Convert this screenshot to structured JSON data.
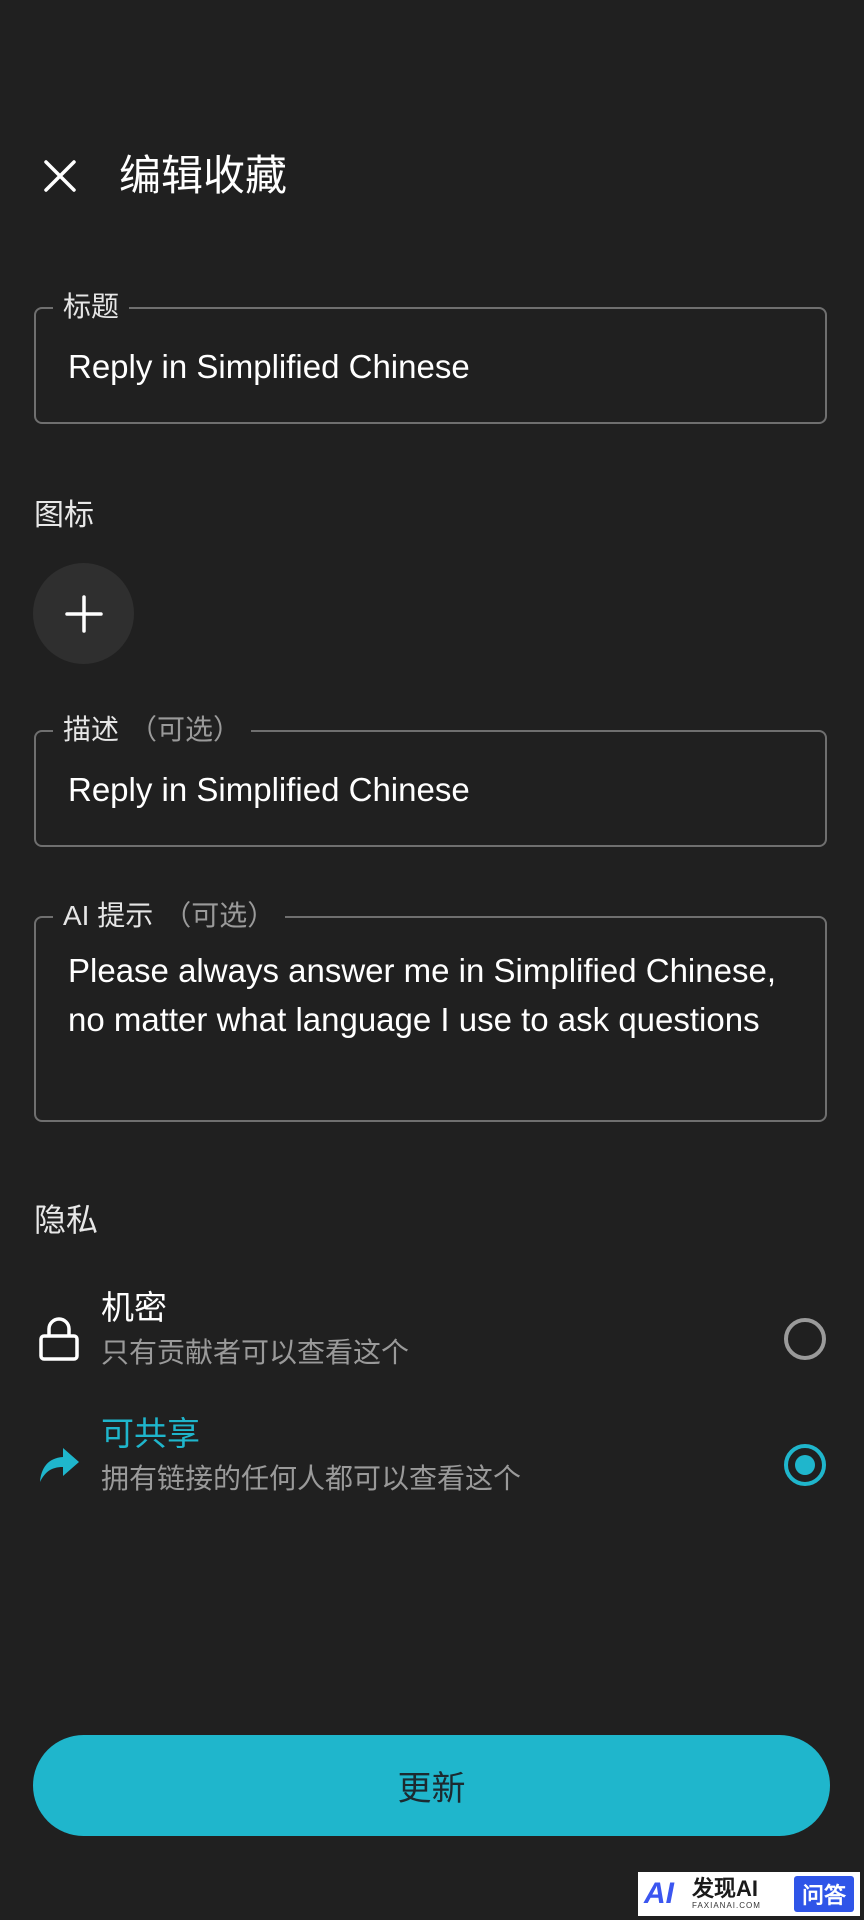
{
  "header": {
    "close_icon": "close-icon",
    "title": "编辑收藏"
  },
  "title_field": {
    "label": "标题",
    "value": "Reply in Simplified Chinese"
  },
  "icon_section": {
    "label": "图标",
    "add_icon": "plus-icon"
  },
  "description_field": {
    "label": "描述",
    "optional": "（可选）",
    "value": "Reply in Simplified Chinese"
  },
  "prompt_field": {
    "label": "AI 提示",
    "optional": "（可选）",
    "value": "Please always answer me in Simplified Chinese, no matter what language I use to ask questions"
  },
  "privacy": {
    "label": "隐私",
    "options": [
      {
        "icon": "lock-icon",
        "title": "机密",
        "description": "只有贡献者可以查看这个",
        "selected": false
      },
      {
        "icon": "share-icon",
        "title": "可共享",
        "description": "拥有链接的任何人都可以查看这个",
        "selected": true
      }
    ]
  },
  "update_button": {
    "label": "更新"
  },
  "watermark": {
    "logo": "AI",
    "brand": "发现AI",
    "brand_sub": "FAXIANAI.COM",
    "badge": "问答"
  },
  "colors": {
    "background": "#202020",
    "accent": "#1fb6cc",
    "border": "#6f6f6f",
    "muted_text": "#9a9a9a"
  }
}
